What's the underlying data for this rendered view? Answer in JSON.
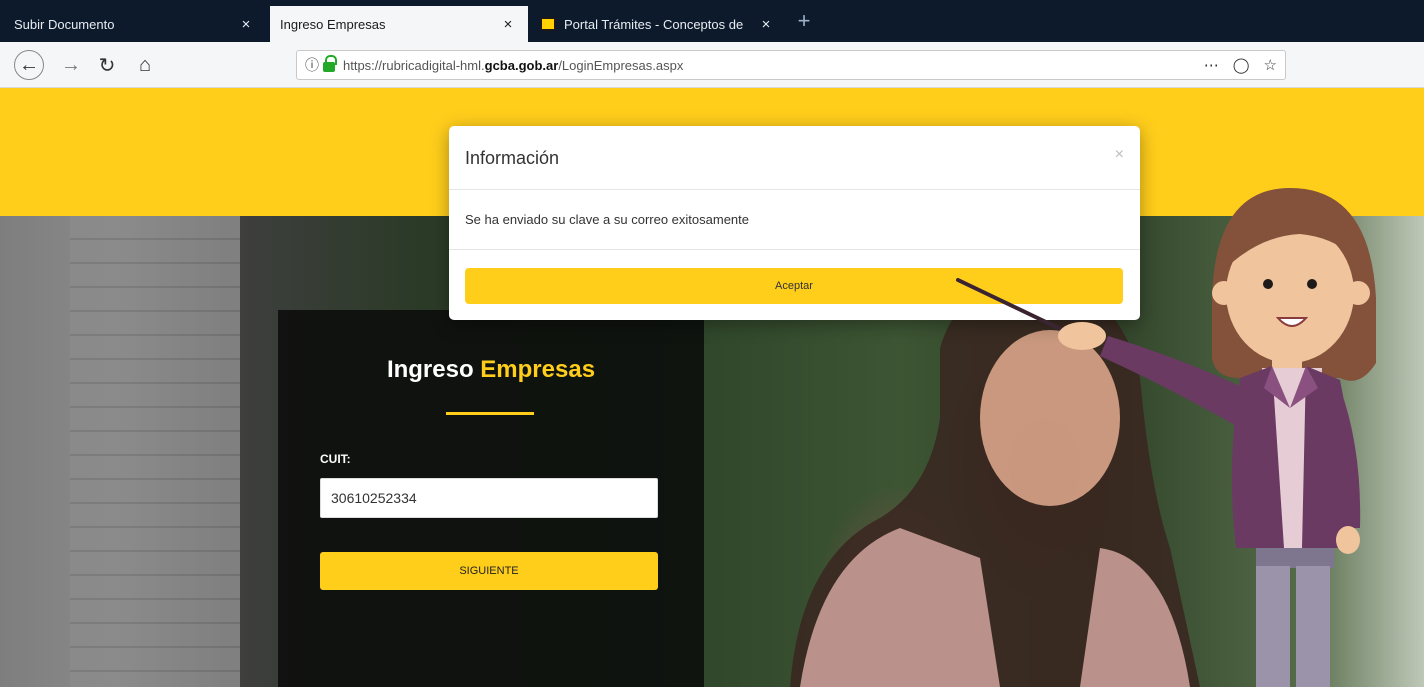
{
  "browser": {
    "tabs": [
      {
        "label": "Subir Documento",
        "active": false
      },
      {
        "label": "Ingreso Empresas",
        "active": true
      },
      {
        "label": "Portal Trámites - Conceptos de",
        "active": false
      }
    ],
    "tab_close_glyph": "×",
    "new_tab_glyph": "+",
    "url_prefix": "https://rubricadigital-hml.",
    "url_domain": "gcba.gob.ar",
    "url_suffix": "/LoginEmpresas.aspx",
    "icons": {
      "back": "back-arrow-icon",
      "forward": "forward-arrow-icon",
      "reload": "reload-icon",
      "home": "home-icon",
      "info": "info-icon",
      "lock": "lock-icon",
      "more": "more-actions-icon",
      "pocket": "pocket-icon",
      "bookmark": "bookmark-star-icon"
    }
  },
  "login": {
    "title_part1": "Ingreso",
    "title_part2": "Empresas",
    "cuit_label": "CUIT:",
    "cuit_value": "30610252334",
    "next_label": "SIGUIENTE"
  },
  "modal": {
    "title": "Información",
    "close_glyph": "×",
    "message": "Se ha enviado su clave a su correo exitosamente",
    "accept_label": "Aceptar"
  },
  "colors": {
    "brand_yellow": "#ffce1b",
    "tabbar": "#0c1a2b"
  }
}
